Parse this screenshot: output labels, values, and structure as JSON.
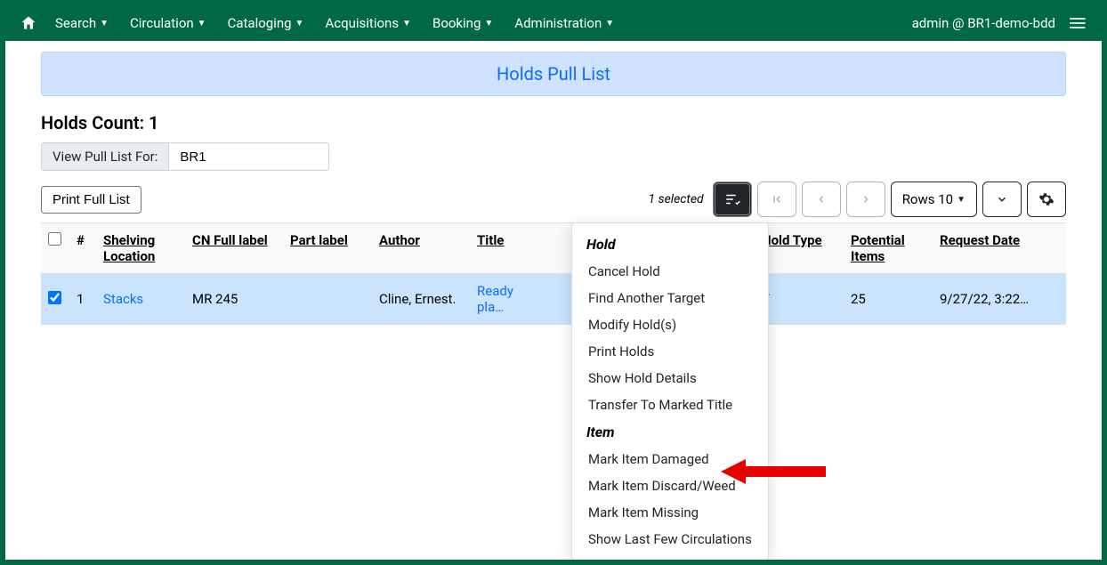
{
  "nav": {
    "items": [
      "Search",
      "Circulation",
      "Cataloging",
      "Acquisitions",
      "Booking",
      "Administration"
    ],
    "user": "admin @ BR1-demo-bdd"
  },
  "page": {
    "title": "Holds Pull List",
    "holds_count_label": "Holds Count: 1",
    "filter_label": "View Pull List For:",
    "filter_value": "BR1",
    "print_btn": "Print Full List"
  },
  "pager": {
    "selected": "1 selected",
    "rows": "Rows 10"
  },
  "columns": [
    "#",
    "Shelving Location",
    "CN Full label",
    "Part label",
    "Author",
    "Title",
    "",
    "Hold Type",
    "Potential Items",
    "Request Date"
  ],
  "row": {
    "num": "1",
    "shelving": "Stacks",
    "cn": "MR 245",
    "part": "",
    "author": "Cline, Ernest.",
    "title": "Ready pla…",
    "hold_type": "T",
    "potential": "25",
    "request_date": "9/27/22, 3:22…"
  },
  "menu": {
    "h1": "Hold",
    "h2": "Item",
    "hold_items": [
      "Cancel Hold",
      "Find Another Target",
      "Modify Hold(s)",
      "Print Holds",
      "Show Hold Details",
      "Transfer To Marked Title"
    ],
    "item_items": [
      "Mark Item Damaged",
      "Mark Item Discard/Weed",
      "Mark Item Missing",
      "Show Last Few Circulations"
    ]
  }
}
